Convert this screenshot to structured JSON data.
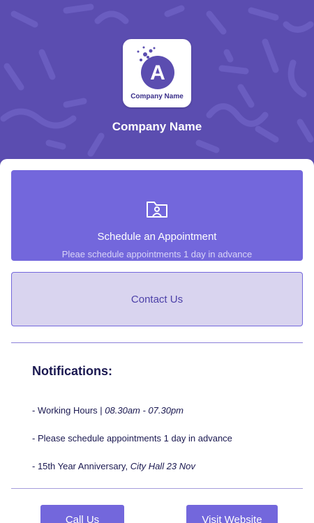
{
  "header": {
    "logo_text": "Company Name",
    "logo_letter": "A",
    "title": "Company Name"
  },
  "appointment": {
    "title": "Schedule an Appointment",
    "subtitle": "Pleae schedule appointments 1 day in advance",
    "icon": "folder-user-icon"
  },
  "contact": {
    "label": "Contact Us"
  },
  "notifications": {
    "title": "Notifications:",
    "items": [
      {
        "prefix": "- Working Hours | ",
        "emphasis": "08.30am - 07.30pm"
      },
      {
        "prefix": "- Please schedule appointments 1 day in advance",
        "emphasis": ""
      },
      {
        "prefix": "- 15th Year Anniversary, ",
        "emphasis": "City Hall 23 Nov"
      }
    ]
  },
  "buttons": {
    "call": "Call Us",
    "website": "Visit Website"
  },
  "colors": {
    "header_bg": "#5b4db0",
    "accent": "#7367dc",
    "contact_bg": "#d9d4ef",
    "text_dark": "#1a1850"
  }
}
